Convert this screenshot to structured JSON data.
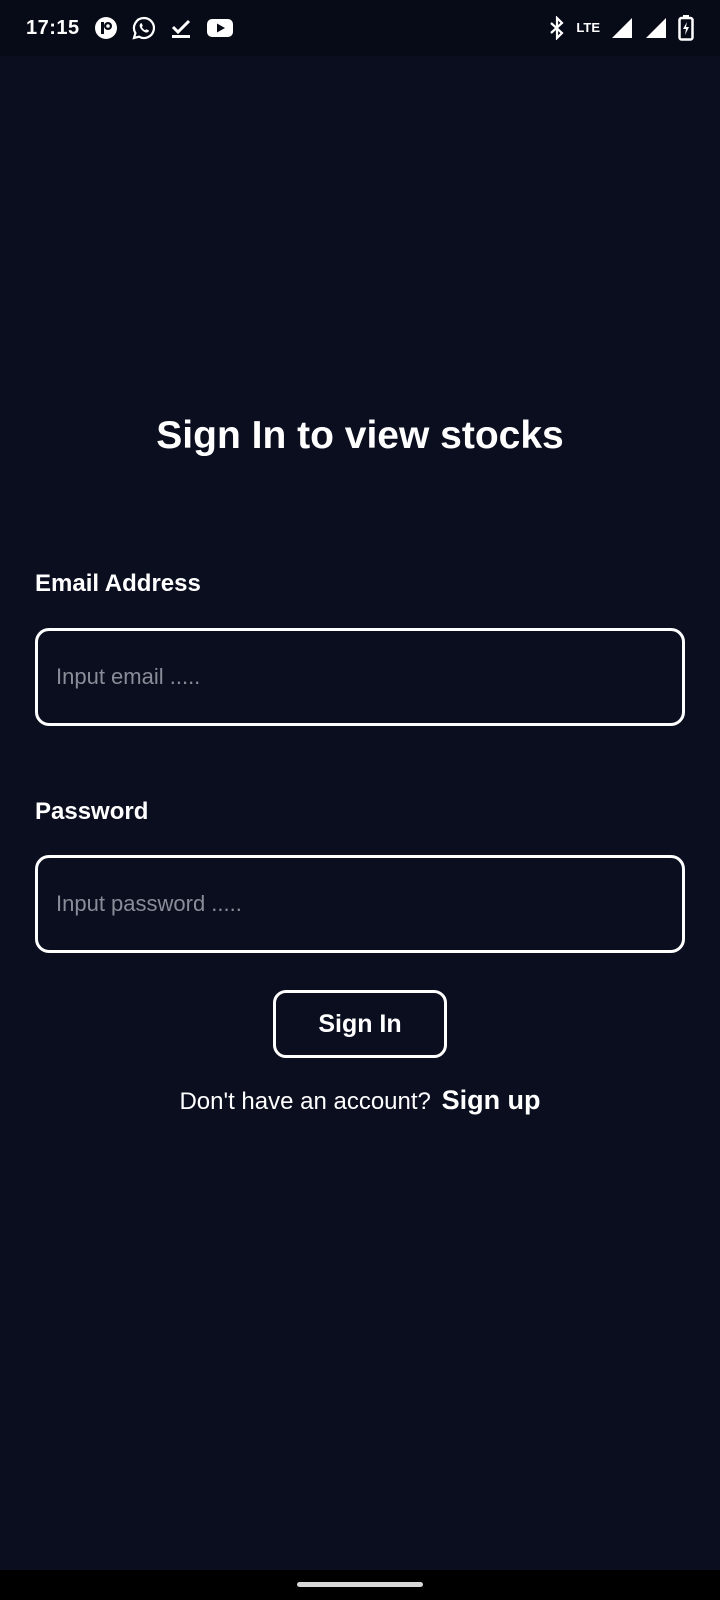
{
  "status_bar": {
    "time": "17:15",
    "left_icons": [
      "podcast-app-icon",
      "whatsapp-icon",
      "download-done-icon",
      "youtube-icon"
    ],
    "right_icons": [
      "bluetooth-icon",
      "lte-icon",
      "signal-icon",
      "signal-icon",
      "battery-charging-icon"
    ],
    "lte_label": "LTE"
  },
  "page": {
    "title": "Sign In to view stocks"
  },
  "form": {
    "email_label": "Email Address",
    "email_placeholder": "Input email .....",
    "email_value": "",
    "password_label": "Password",
    "password_placeholder": "Input password .....",
    "password_value": "",
    "submit_label": "Sign In"
  },
  "footer": {
    "prompt": "Don't have an account?",
    "signup_label": "Sign up"
  },
  "colors": {
    "background": "#0a0e1f",
    "foreground": "#ffffff",
    "placeholder": "#8a8d98"
  }
}
